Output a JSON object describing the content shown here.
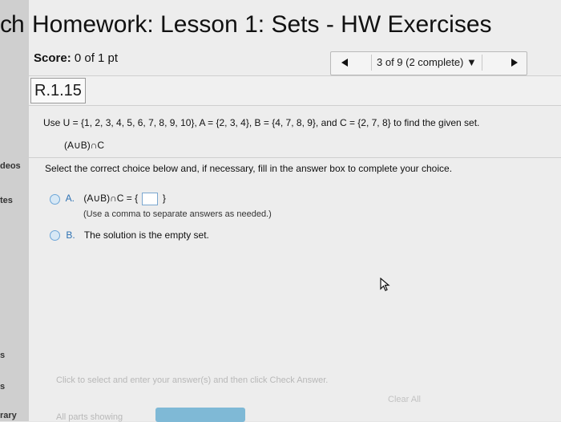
{
  "sidebar": {
    "brand_fragment": "ch",
    "items": [
      "deos",
      "tes",
      "s",
      "s",
      "rary"
    ]
  },
  "header": {
    "title": "Homework: Lesson 1: Sets - HW Exercises",
    "score_label": "Score:",
    "score_value": "0 of 1 pt"
  },
  "navigator": {
    "counter": "3 of 9 (2 complete) ▼",
    "prev_icon": "left-triangle",
    "next_icon": "right-triangle"
  },
  "question": {
    "id": "R.1.15",
    "prompt": "Use U = {1, 2, 3, 4, 5, 6, 7, 8, 9, 10}, A = {2, 3, 4}, B = {4, 7, 8, 9}, and C = {2, 7, 8} to find the given set.",
    "expression": "(A∪B)∩C",
    "instruction": "Select the correct choice below and, if necessary, fill in the answer box to complete your choice.",
    "choices": [
      {
        "letter": "A.",
        "text_before": "(A∪B)∩C = {",
        "text_after": "}",
        "hint": "(Use a comma to separate answers as needed.)"
      },
      {
        "letter": "B.",
        "text": "The solution is the empty set."
      }
    ]
  },
  "footer": {
    "message": "Click to select and enter your answer(s) and then click Check Answer.",
    "clear_all": "Clear All",
    "parts_showing": "All parts showing"
  },
  "colors": {
    "accent": "#2e72b3",
    "check_button": "#7fb9d6"
  }
}
